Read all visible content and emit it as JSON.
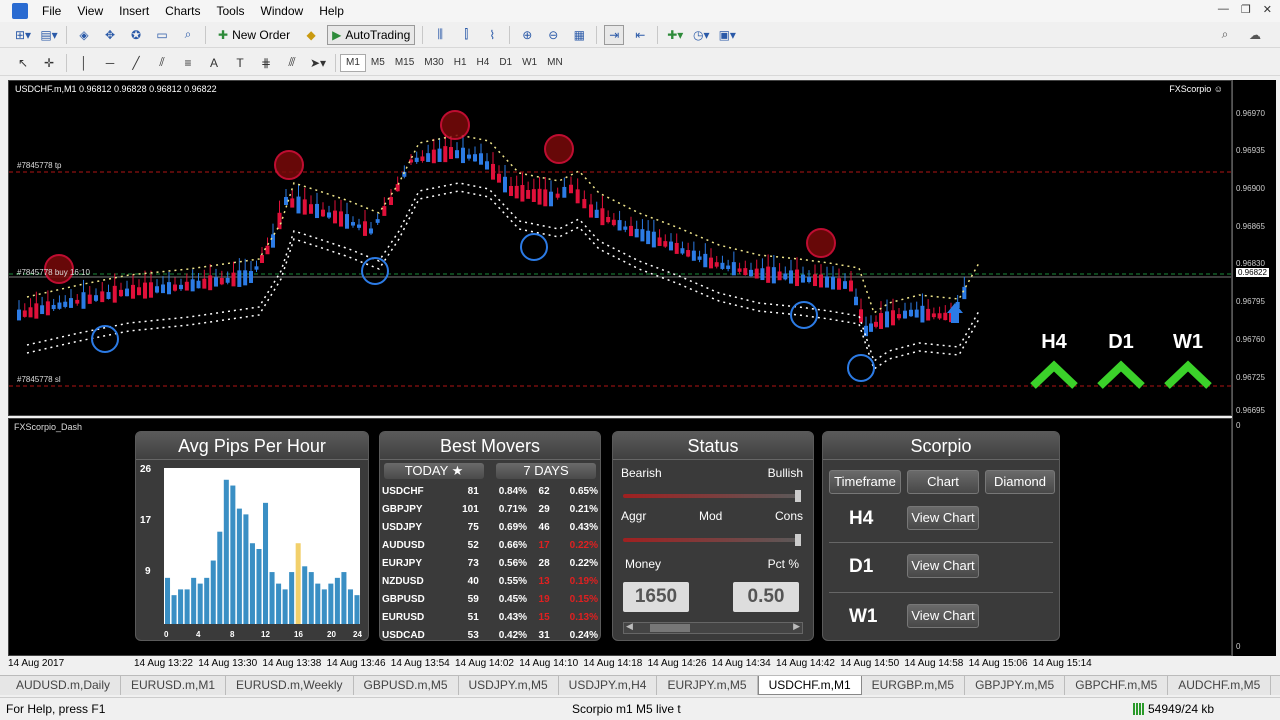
{
  "menu": [
    "File",
    "View",
    "Insert",
    "Charts",
    "Tools",
    "Window",
    "Help"
  ],
  "toolbar": {
    "new_order": "New Order",
    "autotrading": "AutoTrading"
  },
  "timeframes": [
    "M1",
    "M5",
    "M15",
    "M30",
    "H1",
    "H4",
    "D1",
    "W1",
    "MN"
  ],
  "chart": {
    "header": "USDCHF.m,M1  0.96812 0.96828 0.96812 0.96822",
    "brand": "FXScorpio ☺",
    "order_tp": "#7845778 tp",
    "order_buy": "#7845778 buy 16:10",
    "order_sl": "#7845778 sl",
    "prices": [
      "0.96970",
      "0.96935",
      "0.96900",
      "0.96865",
      "0.96830",
      "0.96795",
      "0.96760",
      "0.96725",
      "0.96695"
    ],
    "current_price": "0.96822",
    "tf_signals": [
      "H4",
      "D1",
      "W1"
    ]
  },
  "dash": {
    "title": "FXScorpio_Dash",
    "sub_axis_top": "0",
    "sub_axis_bottom": "0",
    "avg": {
      "title": "Avg Pips Per Hour",
      "y_ticks": [
        "26",
        "17",
        "9"
      ],
      "x_ticks": [
        "0",
        "4",
        "8",
        "12",
        "16",
        "20",
        "24"
      ]
    },
    "movers": {
      "title": "Best Movers",
      "tab_today": "TODAY ★",
      "tab_7days": "7 DAYS",
      "rows": [
        {
          "pair": "USDCHF",
          "p1": "81",
          "c1": "0.84%",
          "p2": "62",
          "c2": "0.65%",
          "neg": false
        },
        {
          "pair": "GBPJPY",
          "p1": "101",
          "c1": "0.71%",
          "p2": "29",
          "c2": "0.21%",
          "neg": false
        },
        {
          "pair": "USDJPY",
          "p1": "75",
          "c1": "0.69%",
          "p2": "46",
          "c2": "0.43%",
          "neg": false
        },
        {
          "pair": "AUDUSD",
          "p1": "52",
          "c1": "0.66%",
          "p2": "17",
          "c2": "0.22%",
          "neg": true
        },
        {
          "pair": "EURJPY",
          "p1": "73",
          "c1": "0.56%",
          "p2": "28",
          "c2": "0.22%",
          "neg": false
        },
        {
          "pair": "NZDUSD",
          "p1": "40",
          "c1": "0.55%",
          "p2": "13",
          "c2": "0.19%",
          "neg": true
        },
        {
          "pair": "GBPUSD",
          "p1": "59",
          "c1": "0.45%",
          "p2": "19",
          "c2": "0.15%",
          "neg": true
        },
        {
          "pair": "EURUSD",
          "p1": "51",
          "c1": "0.43%",
          "p2": "15",
          "c2": "0.13%",
          "neg": true
        },
        {
          "pair": "USDCAD",
          "p1": "53",
          "c1": "0.42%",
          "p2": "31",
          "c2": "0.24%",
          "neg": false
        }
      ]
    },
    "status": {
      "title": "Status",
      "bearish": "Bearish",
      "bullish": "Bullish",
      "aggr": "Aggr",
      "mod": "Mod",
      "cons": "Cons",
      "money": "Money",
      "pct": "Pct %",
      "money_value": "1650",
      "pct_value": "0.50"
    },
    "scorpio": {
      "title": "Scorpio",
      "btn_timeframe": "Timeframe",
      "btn_chart": "Chart",
      "btn_diamond": "Diamond",
      "rows": [
        {
          "tf": "H4",
          "btn": "View Chart"
        },
        {
          "tf": "D1",
          "btn": "View Chart"
        },
        {
          "tf": "W1",
          "btn": "View Chart"
        }
      ]
    }
  },
  "time_axis": [
    "14 Aug 2017",
    "14 Aug 13:22",
    "14 Aug 13:30",
    "14 Aug 13:38",
    "14 Aug 13:46",
    "14 Aug 13:54",
    "14 Aug 14:02",
    "14 Aug 14:10",
    "14 Aug 14:18",
    "14 Aug 14:26",
    "14 Aug 14:34",
    "14 Aug 14:42",
    "14 Aug 14:50",
    "14 Aug 14:58",
    "14 Aug 15:06",
    "14 Aug 15:14"
  ],
  "tabs": [
    "AUDUSD.m,Daily",
    "EURUSD.m,M1",
    "EURUSD.m,Weekly",
    "GBPUSD.m,M5",
    "USDJPY.m,M5",
    "USDJPY.m,H4",
    "EURJPY.m,M5",
    "USDCHF.m,M1",
    "EURGBP.m,M5",
    "GBPJPY.m,M5",
    "GBPCHF.m,M5",
    "AUDCHF.m,M5"
  ],
  "active_tab": "USDCHF.m,M1",
  "status": {
    "help": "For Help, press F1",
    "profile": "Scorpio m1 M5 live t",
    "traffic": "54949/24 kb"
  },
  "colors": {
    "bull": "#2c7be5",
    "bear": "#e0103a",
    "signal": "#3bd12a",
    "background": "#000000"
  }
}
